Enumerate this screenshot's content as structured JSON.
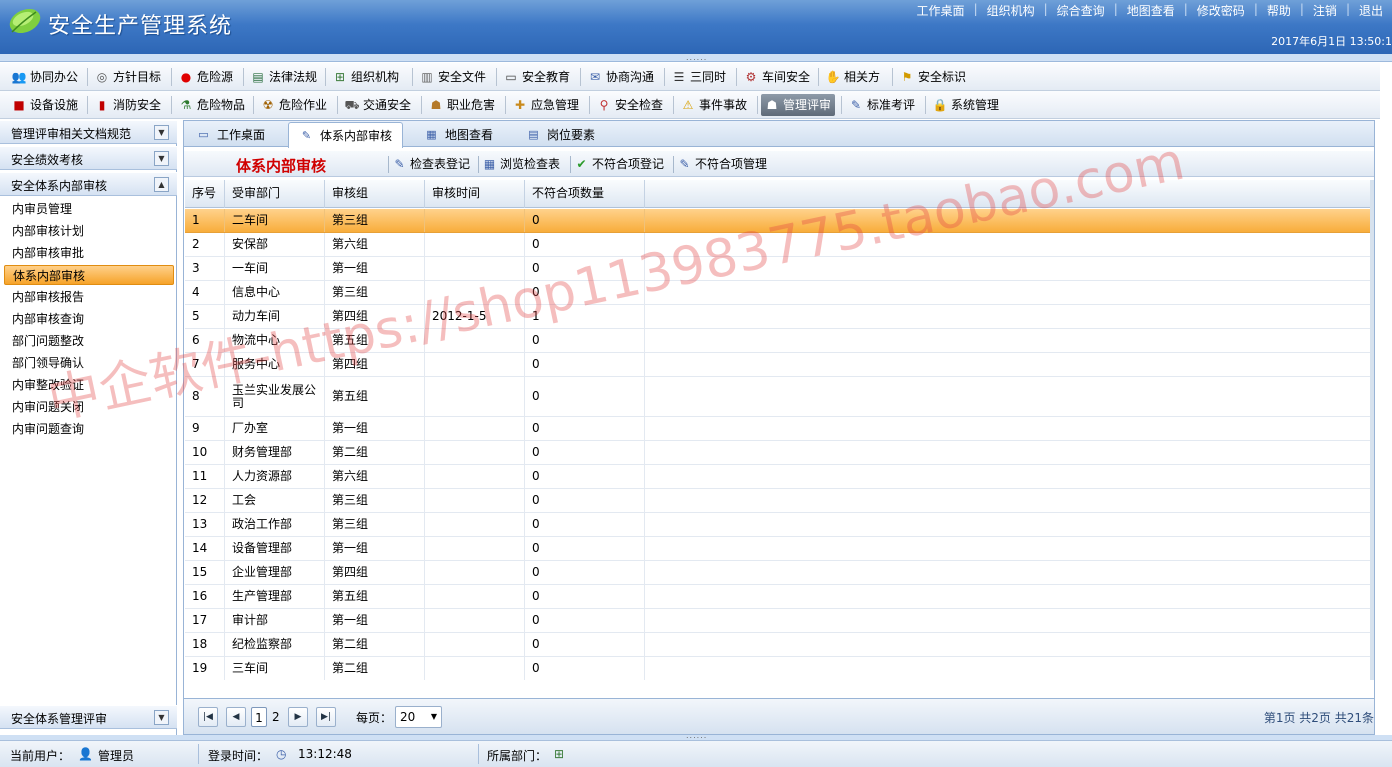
{
  "app": {
    "title": "安全生产管理系统",
    "top_links": [
      "工作桌面",
      "组织机构",
      "综合查询",
      "地图查看",
      "修改密码",
      "帮助",
      "注销",
      "退出"
    ],
    "date": "2017年6月1日  13:50:1"
  },
  "menu_row1": [
    {
      "label": "协同办公",
      "icon": "people-icon",
      "glyph": "👥",
      "color": "#c98a1c"
    },
    {
      "label": "方针目标",
      "icon": "target-icon",
      "glyph": "◎",
      "color": "#555"
    },
    {
      "label": "危险源",
      "icon": "red-dot-icon",
      "glyph": "●",
      "color": "#e00000"
    },
    {
      "label": "法律法规",
      "icon": "book-icon",
      "glyph": "▤",
      "color": "#2a6e3f"
    },
    {
      "label": "组织机构",
      "icon": "org-chart-icon",
      "glyph": "⊞",
      "color": "#3a7b3a"
    },
    {
      "label": "安全文件",
      "icon": "file-icon",
      "glyph": "▥",
      "color": "#666"
    },
    {
      "label": "安全教育",
      "icon": "speech-bubble-icon",
      "glyph": "▭",
      "color": "#444"
    },
    {
      "label": "协商沟通",
      "icon": "mail-icon",
      "glyph": "✉",
      "color": "#3b5fa8"
    },
    {
      "label": "三同时",
      "icon": "list-icon",
      "glyph": "☰",
      "color": "#333"
    },
    {
      "label": "车间安全",
      "icon": "worker-icon",
      "glyph": "⚙",
      "color": "#b03030"
    },
    {
      "label": "相关方",
      "icon": "handshake-icon",
      "glyph": "✋",
      "color": "#c98a1c"
    },
    {
      "label": "安全标识",
      "icon": "flag-icon",
      "glyph": "⚑",
      "color": "#d29a00"
    }
  ],
  "menu_row2": [
    {
      "label": "设备设施",
      "icon": "red-box-icon",
      "glyph": "■",
      "color": "#c00000"
    },
    {
      "label": "消防安全",
      "icon": "extinguisher-icon",
      "glyph": "▮",
      "color": "#c00000"
    },
    {
      "label": "危险物品",
      "icon": "flask-icon",
      "glyph": "⚗",
      "color": "#2d7a2d"
    },
    {
      "label": "危险作业",
      "icon": "hazard-icon",
      "glyph": "☢",
      "color": "#a06000"
    },
    {
      "label": "交通安全",
      "icon": "truck-icon",
      "glyph": "⛟",
      "color": "#555"
    },
    {
      "label": "职业危害",
      "icon": "worker-icon",
      "glyph": "☗",
      "color": "#b57a2a"
    },
    {
      "label": "应急管理",
      "icon": "emergency-icon",
      "glyph": "✚",
      "color": "#c98a1c"
    },
    {
      "label": "安全检查",
      "icon": "magnifier-icon",
      "glyph": "⚲",
      "color": "#c03030"
    },
    {
      "label": "事件事故",
      "icon": "warning-icon",
      "glyph": "⚠",
      "color": "#d8a000"
    },
    {
      "label": "管理评审",
      "icon": "group-icon",
      "glyph": "☗",
      "color": "#fff"
    },
    {
      "label": "标准考评",
      "icon": "edit-icon",
      "glyph": "✎",
      "color": "#3b5fa8"
    },
    {
      "label": "系统管理",
      "icon": "lock-icon",
      "glyph": "🔒",
      "color": "#d8a000"
    }
  ],
  "active_menu": "管理评审",
  "sidebar": {
    "sections": [
      "管理评审相关文档规范",
      "安全绩效考核",
      "安全体系内部审核"
    ],
    "items": [
      "内审员管理",
      "内部审核计划",
      "内部审核审批",
      "体系内部审核",
      "内部审核报告",
      "内部审核查询",
      "部门问题整改",
      "部门领导确认",
      "内审整改验证",
      "内审问题关闭",
      "内审问题查询"
    ],
    "active_item": "体系内部审核",
    "bottom_section": "安全体系管理评审"
  },
  "tabs": [
    {
      "label": "工作桌面",
      "icon": "desktop-icon",
      "glyph": "▭"
    },
    {
      "label": "体系内部审核",
      "icon": "edit-icon",
      "glyph": "✎"
    },
    {
      "label": "地图查看",
      "icon": "map-icon",
      "glyph": "▦"
    },
    {
      "label": "岗位要素",
      "icon": "list-icon",
      "glyph": "▤"
    }
  ],
  "active_tab": "体系内部审核",
  "toolbar": {
    "title": "体系内部审核",
    "buttons": [
      {
        "label": "检查表登记",
        "icon": "edit-icon",
        "glyph": "✎",
        "color": "#3b5fa8"
      },
      {
        "label": "浏览检查表",
        "icon": "grid-icon",
        "glyph": "▦",
        "color": "#3b5fa8"
      },
      {
        "label": "不符合项登记",
        "icon": "checkmark-icon",
        "glyph": "✔",
        "color": "#2a9a2a"
      },
      {
        "label": "不符合项管理",
        "icon": "edit-icon",
        "glyph": "✎",
        "color": "#3b5fa8"
      }
    ]
  },
  "table": {
    "columns": [
      "序号",
      "受审部门",
      "审核组",
      "审核时间",
      "不符合项数量"
    ],
    "rows": [
      [
        "1",
        "二车间",
        "第三组",
        "",
        "0"
      ],
      [
        "2",
        "安保部",
        "第六组",
        "",
        "0"
      ],
      [
        "3",
        "一车间",
        "第一组",
        "",
        "0"
      ],
      [
        "4",
        "信息中心",
        "第三组",
        "",
        "0"
      ],
      [
        "5",
        "动力车间",
        "第四组",
        "2012-1-5",
        "1"
      ],
      [
        "6",
        "物流中心",
        "第五组",
        "",
        "0"
      ],
      [
        "7",
        "服务中心",
        "第四组",
        "",
        "0"
      ],
      [
        "8",
        "玉兰实业发展公司",
        "第五组",
        "",
        "0"
      ],
      [
        "9",
        "厂办室",
        "第一组",
        "",
        "0"
      ],
      [
        "10",
        "财务管理部",
        "第二组",
        "",
        "0"
      ],
      [
        "11",
        "人力资源部",
        "第六组",
        "",
        "0"
      ],
      [
        "12",
        "工会",
        "第三组",
        "",
        "0"
      ],
      [
        "13",
        "政治工作部",
        "第三组",
        "",
        "0"
      ],
      [
        "14",
        "设备管理部",
        "第一组",
        "",
        "0"
      ],
      [
        "15",
        "企业管理部",
        "第四组",
        "",
        "0"
      ],
      [
        "16",
        "生产管理部",
        "第五组",
        "",
        "0"
      ],
      [
        "17",
        "审计部",
        "第一组",
        "",
        "0"
      ],
      [
        "18",
        "纪检监察部",
        "第二组",
        "",
        "0"
      ],
      [
        "19",
        "三车间",
        "第二组",
        "",
        "0"
      ]
    ],
    "selected_row": 0
  },
  "pager": {
    "pages": [
      "1",
      "2"
    ],
    "current": "1",
    "per_page_label": "每页：",
    "per_page_value": "20",
    "info": "第1页  共2页  共21条"
  },
  "status": {
    "user_label": "当前用户：",
    "user": "管理员",
    "login_label": "登录时间：",
    "login_time": "13:12:48",
    "dept_label": "所属部门："
  },
  "watermark": "中企软件-https://shop113983775.taobao.com",
  "colors": {
    "accent": "#2d66b5",
    "selected": "#f8ad3b",
    "title_red": "#d00000"
  }
}
